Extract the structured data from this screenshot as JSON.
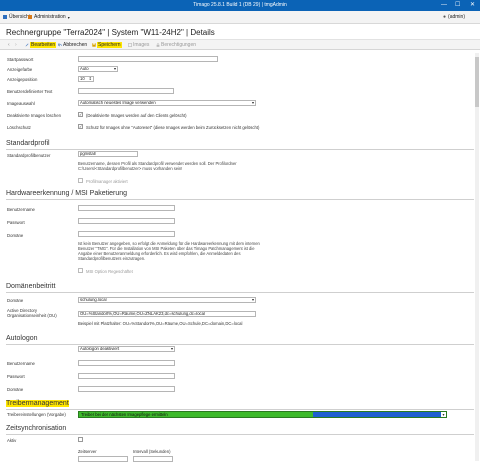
{
  "window": {
    "title": "Timago 25.8.1 Build 1 (DB 29) | tmgAdmin",
    "min": "—",
    "max": "☐",
    "close": "✕"
  },
  "menubar": {
    "items": [
      "Übersicht",
      "Administration"
    ],
    "user": "(admin)"
  },
  "heading": "Rechnergruppe \"Terra2024\" | System \"W11-24H2\" | Details",
  "toolbar": {
    "edit": "Bearbeiten",
    "cancel": "Abbrechen",
    "save": "Speichern",
    "images": "Images",
    "permissions": "Berechtigungen"
  },
  "top_fields": {
    "startpasswort": {
      "label": "Startpasswort",
      "value": ""
    },
    "anzeigefarbe": {
      "label": "Anzeigefarbe",
      "value": "Auto"
    },
    "anzeigeposition": {
      "label": "Anzeigeposition",
      "value": "10"
    },
    "benutzertext": {
      "label": "Benutzerdefinierter Text",
      "value": ""
    },
    "imageauswahl": {
      "label": "Imageauswahl",
      "value": "Automatisch neuestes Image verwenden"
    },
    "deaktivierte": {
      "label": "Deaktivierte Images löschen",
      "text": "(Deaktivierte Images werden auf den Clients gelöscht)"
    },
    "loeschschutz": {
      "label": "Löschschutz",
      "text": "Schutz für Images ohne \"Autoreset\" (diese Images werden beim Zurücksetzen nicht gelöscht)"
    }
  },
  "standardprofil": {
    "title": "Standardprofil",
    "label": "Standardprofilbenutzer",
    "value": "pgmstall",
    "note1": "Benutzername, dessen Profil als Standardprofil verwendet werden soll. Der Profilordner",
    "note2": "C:\\Users\\<Standardprofilbenutzer> muss vorhanden sein!",
    "checkbox_label": "Profilmanager aktiviert"
  },
  "hardware": {
    "title": "Hardwareerkennung / MSI Paketierung",
    "fields": [
      {
        "label": "Benutzername",
        "value": ""
      },
      {
        "label": "Passwort",
        "value": ""
      },
      {
        "label": "Domäne",
        "value": ""
      }
    ],
    "note": [
      "Ist kein Benutzer angegeben, so erfolgt die Anmeldung für die Hardwareerkennung mit dem internen",
      "Benutzer \"TMG\". Für die Installation von MSI Paketen über das Timago Patchmanagement ist die",
      "Angabe einer Benutzeranmeldung erforderlich. Es wird empfohlen, die Anmeldedaten des",
      "Standardprofilbenutzers einzutragen."
    ],
    "checkbox_label": "MSI Option Regeschäftet"
  },
  "domaene": {
    "title": "Domänenbeitritt",
    "domain_label": "Domäne",
    "domain_value": "schulung.local",
    "ad_label1": "Active Directory",
    "ad_label2": "Organisationseinheit (OU)",
    "ad_value": "OU=%Standort%,OU=Räume,OU=ZNLAK23,dc=schulung,dc=local",
    "example": "Beispiel mit Platzhalter: OU=%Standort%,OU=Räume,OU=Schule,DC=domain,DC=local"
  },
  "autologon": {
    "title": "Autologon",
    "select_value": "Autologon deaktiviert",
    "fields": [
      {
        "label": "Benutzername",
        "value": ""
      },
      {
        "label": "Passwort",
        "value": ""
      },
      {
        "label": "Domäne",
        "value": ""
      }
    ]
  },
  "treiber": {
    "title": "Treibermanagement",
    "label": "Treibereinstellungen (Vorgabe)",
    "value": "Treiber bei der nächsten Imagepflege ermitteln"
  },
  "zeitsync": {
    "title": "Zeitsynchronisation",
    "aktiv_label": "Aktiv",
    "col1": "Zeitserver",
    "col2": "Intervall (Sekunden)"
  },
  "colors": {
    "titlebar": "#0b63b6",
    "highlight": "#ffe600",
    "treiber_green": "#3dba2b",
    "treiber_blue": "#1f5fd0"
  }
}
